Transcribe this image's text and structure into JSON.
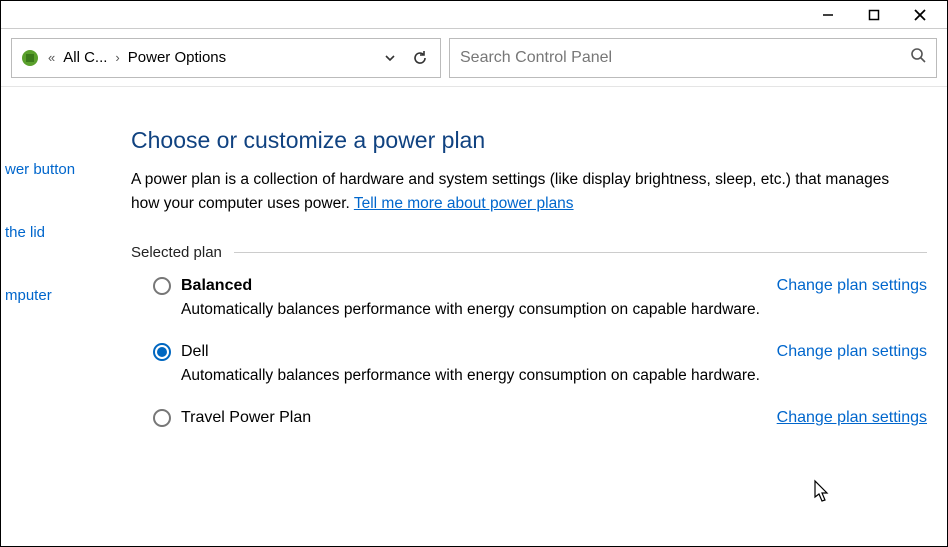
{
  "window": {
    "minimize": "—",
    "maximize": "□",
    "close": "✕"
  },
  "breadcrumb": {
    "back_chevrons": "«",
    "crumb1": "All C...",
    "sep": "›",
    "crumb2": "Power Options"
  },
  "search": {
    "placeholder": "Search Control Panel"
  },
  "sidebar": {
    "link1": "wer button",
    "link2": "the lid",
    "link3": "mputer"
  },
  "main": {
    "heading": "Choose or customize a power plan",
    "blurb_pre": "A power plan is a collection of hardware and system settings (like display brightness, sleep, etc.) that manages how your computer uses power. ",
    "blurb_link": "Tell me more about power plans",
    "group_label": "Selected plan",
    "change_link": "Change plan settings",
    "plans": [
      {
        "name": "Balanced",
        "bold": true,
        "selected": false,
        "desc": "Automatically balances performance with energy consumption on capable hardware."
      },
      {
        "name": "Dell",
        "bold": false,
        "selected": true,
        "desc": "Automatically balances performance with energy consumption on capable hardware."
      },
      {
        "name": "Travel Power Plan",
        "bold": false,
        "selected": false,
        "desc": ""
      }
    ]
  }
}
